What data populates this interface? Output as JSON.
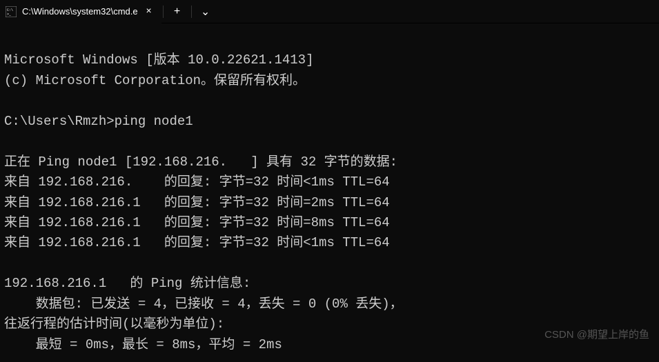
{
  "tab": {
    "title": "C:\\Windows\\system32\\cmd.e",
    "close_glyph": "×"
  },
  "titlebar": {
    "new_tab_glyph": "+",
    "dropdown_glyph": "⌄"
  },
  "terminal": {
    "banner": "Microsoft Windows [版本 10.0.22621.1413]",
    "copyright": "(c) Microsoft Corporation。保留所有权利。",
    "prompt": "C:\\Users\\Rmzh>",
    "command": "ping node1",
    "pinging": "正在 Ping node1 [192.168.216.   ] 具有 32 字节的数据:",
    "reply1": "来自 192.168.216.    的回复: 字节=32 时间<1ms TTL=64",
    "reply2": "来自 192.168.216.1   的回复: 字节=32 时间=2ms TTL=64",
    "reply3": "来自 192.168.216.1   的回复: 字节=32 时间=8ms TTL=64",
    "reply4": "来自 192.168.216.1   的回复: 字节=32 时间<1ms TTL=64",
    "stats_header": "192.168.216.1   的 Ping 统计信息:",
    "stats_packets": "    数据包: 已发送 = 4，已接收 = 4，丢失 = 0 (0% 丢失)，",
    "stats_rtt_header": "往返行程的估计时间(以毫秒为单位):",
    "stats_rtt": "    最短 = 0ms，最长 = 8ms，平均 = 2ms"
  },
  "watermark": {
    "center": "",
    "bottom_right": "CSDN @期望上岸的鱼"
  }
}
